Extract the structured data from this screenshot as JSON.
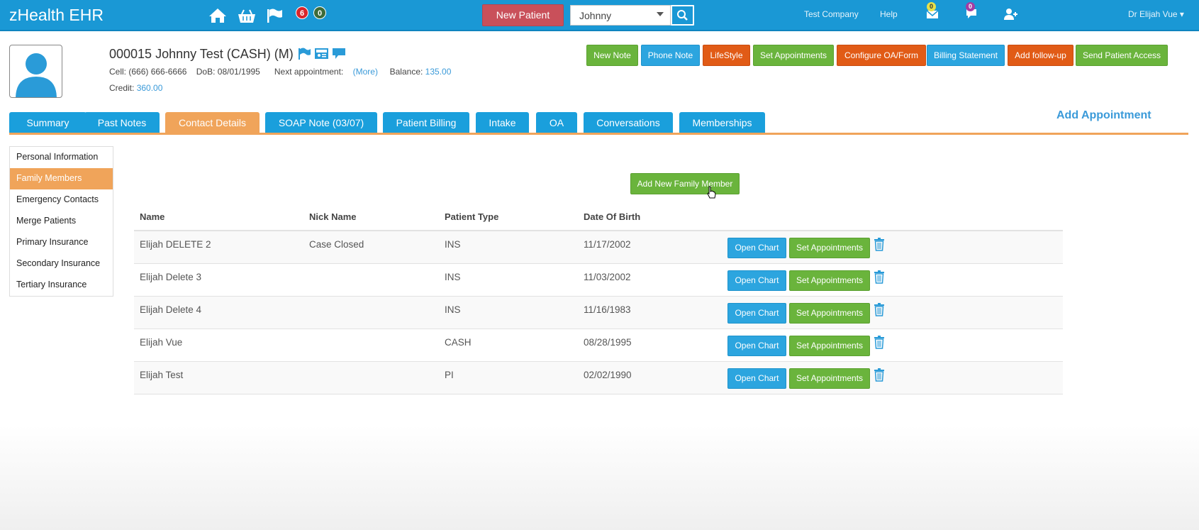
{
  "app": {
    "brand": "zHealth EHR"
  },
  "topbar": {
    "badge_red": "6",
    "badge_dark": "0",
    "new_patient_label": "New Patient",
    "search_value": "Johnny",
    "company": "Test Company",
    "help": "Help",
    "mail_count": "0",
    "chat_count": "0",
    "user": "Dr Elijah Vue"
  },
  "patient": {
    "title": "000015 Johnny Test  (CASH) (M)",
    "cell_label": "Cell:",
    "cell": "(666) 666-6666",
    "dob_label": "DoB:",
    "dob": "08/01/1995",
    "next_appt_label": "Next appointment:",
    "next_appt_link": "(More)",
    "balance_label": "Balance:",
    "balance": "135.00",
    "credit_label": "Credit:",
    "credit": "360.00"
  },
  "actions": [
    "New Note",
    "Phone Note",
    "LifeStyle",
    "Set Appointments",
    "Configure OA/Form",
    "Billing Statement",
    "Add follow-up",
    "Send Patient Access"
  ],
  "add_appointment": "Add Appointment",
  "tabs": [
    "Summary",
    "Past Notes",
    "Contact Details",
    "SOAP Note (03/07)",
    "Patient Billing",
    "Intake",
    "OA",
    "Conversations",
    "Memberships"
  ],
  "sidebar": [
    "Personal Information",
    "Family Members",
    "Emergency Contacts",
    "Merge Patients",
    "Primary Insurance",
    "Secondary Insurance",
    "Tertiary Insurance"
  ],
  "add_family_member": "Add New Family Member",
  "table": {
    "headers": [
      "Name",
      "Nick Name",
      "Patient Type",
      "Date Of Birth"
    ],
    "open_chart_label": "Open Chart",
    "set_appt_label": "Set Appointments",
    "rows": [
      {
        "name": "Elijah DELETE 2",
        "nick": "Case Closed",
        "type": "INS",
        "dob": "11/17/2002"
      },
      {
        "name": "Elijah Delete 3",
        "nick": "",
        "type": "INS",
        "dob": "11/03/2002"
      },
      {
        "name": "Elijah Delete 4",
        "nick": "",
        "type": "INS",
        "dob": "11/16/1983"
      },
      {
        "name": "Elijah Vue",
        "nick": "",
        "type": "CASH",
        "dob": "08/28/1995"
      },
      {
        "name": "Elijah Test",
        "nick": "",
        "type": "PI",
        "dob": "02/02/1990"
      }
    ]
  }
}
